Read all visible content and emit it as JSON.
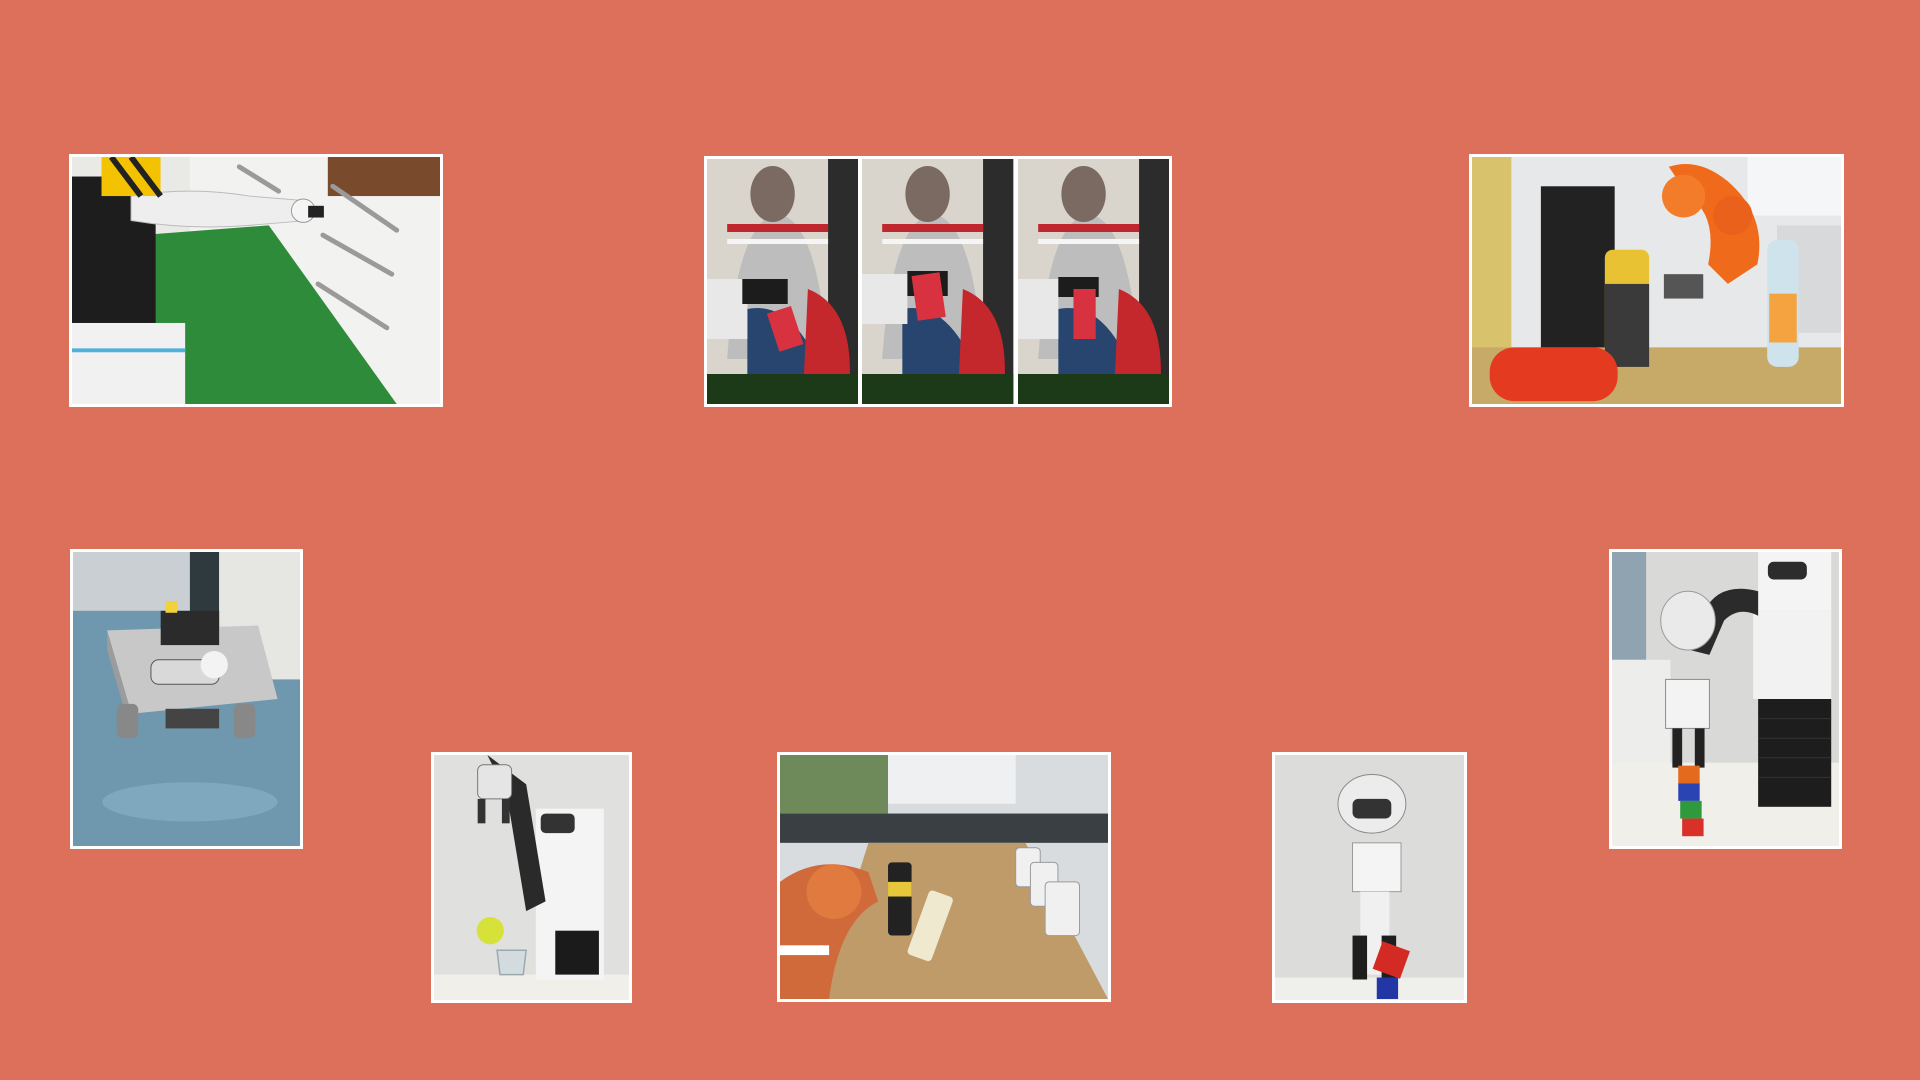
{
  "canvas": {
    "background": "#dd705a",
    "border_color": "#ffffff"
  },
  "photos": [
    {
      "id": "kitchen",
      "subject": "robot-opening-kitchen-drawer"
    },
    {
      "id": "handover",
      "subject": "robot-handing-box-to-person",
      "frame_count": 3
    },
    {
      "id": "orange-arm",
      "subject": "orange-arm-grasping-can-near-bottle-and-ketchup"
    },
    {
      "id": "mobile-base",
      "subject": "small-mobile-robot-platform-on-floor"
    },
    {
      "id": "ball-drop",
      "subject": "robot-arm-dropping-tennis-ball-into-glass"
    },
    {
      "id": "table-cans",
      "subject": "arm-pushing-cans-on-conference-table"
    },
    {
      "id": "cube-place",
      "subject": "robot-placing-red-cube-on-blue-cube"
    },
    {
      "id": "cube-stack",
      "subject": "robot-stacking-colored-cubes"
    }
  ]
}
